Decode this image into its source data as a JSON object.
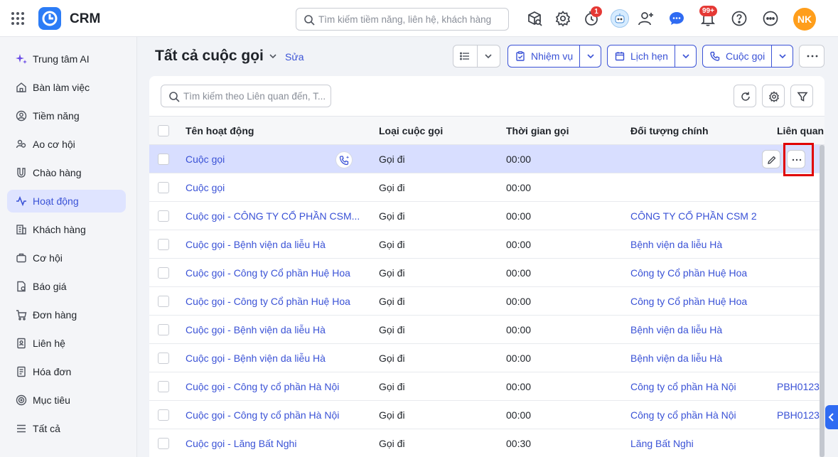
{
  "app": {
    "title": "CRM"
  },
  "search": {
    "placeholder": "Tìm kiếm tiềm năng, liên hệ, khách hàng"
  },
  "topbar": {
    "icons": [
      "package-search-icon",
      "gear-icon",
      "timer-icon",
      "robot-avatar-icon",
      "add-user-icon",
      "chat-icon",
      "bell-icon",
      "help-icon",
      "more-icon"
    ],
    "timer_badge": "1",
    "bell_badge": "99+",
    "avatar_initials": "NK"
  },
  "sidebar": {
    "items": [
      {
        "label": "Trung tâm AI",
        "icon": "sparkle-icon"
      },
      {
        "label": "Bàn làm việc",
        "icon": "home-icon"
      },
      {
        "label": "Tiềm năng",
        "icon": "user-circle-icon"
      },
      {
        "label": "Ao cơ hội",
        "icon": "people-icon"
      },
      {
        "label": "Chào hàng",
        "icon": "magnet-icon"
      },
      {
        "label": "Hoạt động",
        "icon": "activity-icon",
        "active": true
      },
      {
        "label": "Khách hàng",
        "icon": "building-icon"
      },
      {
        "label": "Cơ hội",
        "icon": "briefcase-icon"
      },
      {
        "label": "Báo giá",
        "icon": "quote-doc-icon"
      },
      {
        "label": "Đơn hàng",
        "icon": "cart-icon"
      },
      {
        "label": "Liên hệ",
        "icon": "contact-book-icon"
      },
      {
        "label": "Hóa đơn",
        "icon": "invoice-icon"
      },
      {
        "label": "Mục tiêu",
        "icon": "target-icon"
      },
      {
        "label": "Tất cả",
        "icon": "menu-icon"
      }
    ]
  },
  "header": {
    "title": "Tất cả cuộc gọi",
    "edit_label": "Sửa",
    "buttons": {
      "task": "Nhiệm vụ",
      "appointment": "Lịch hẹn",
      "call": "Cuộc gọi"
    }
  },
  "table": {
    "search_placeholder": "Tìm kiếm theo Liên quan đến, T...",
    "columns": [
      "Tên hoạt động",
      "Loại cuộc gọi",
      "Thời gian gọi",
      "Đối tượng chính",
      "Liên quan đ"
    ],
    "rows": [
      {
        "name": "Cuộc gọi",
        "type": "Gọi đi",
        "time": "00:00",
        "object": "",
        "related": ""
      },
      {
        "name": "Cuộc gọi",
        "type": "Gọi đi",
        "time": "00:00",
        "object": "",
        "related": ""
      },
      {
        "name": "Cuộc gọi - CÔNG TY CỔ PHẦN CSM...",
        "type": "Gọi đi",
        "time": "00:00",
        "object": "CÔNG TY CỔ PHẦN CSM 2",
        "related": ""
      },
      {
        "name": "Cuộc gọi - Bệnh viện da liễu Hà",
        "type": "Gọi đi",
        "time": "00:00",
        "object": "Bệnh viện da liễu Hà",
        "related": ""
      },
      {
        "name": "Cuộc gọi - Công ty Cổ phần Huệ Hoa",
        "type": "Gọi đi",
        "time": "00:00",
        "object": "Công ty Cổ phần Huệ Hoa",
        "related": ""
      },
      {
        "name": "Cuộc gọi - Công ty Cổ phần Huệ Hoa",
        "type": "Gọi đi",
        "time": "00:00",
        "object": "Công ty Cổ phần Huệ Hoa",
        "related": ""
      },
      {
        "name": "Cuộc gọi - Bệnh viện da liễu Hà",
        "type": "Gọi đi",
        "time": "00:00",
        "object": "Bệnh viện da liễu Hà",
        "related": ""
      },
      {
        "name": "Cuộc gọi - Bệnh viện da liễu Hà",
        "type": "Gọi đi",
        "time": "00:00",
        "object": "Bệnh viện da liễu Hà",
        "related": ""
      },
      {
        "name": "Cuộc gọi - Công ty cổ phần Hà Nội",
        "type": "Gọi đi",
        "time": "00:00",
        "object": "Công ty cổ phần Hà Nội",
        "related": "PBH0123"
      },
      {
        "name": "Cuộc gọi - Công ty cổ phần Hà Nội",
        "type": "Gọi đi",
        "time": "00:00",
        "object": "Công ty cổ phần Hà Nội",
        "related": "PBH0123"
      },
      {
        "name": "Cuộc gọi - Lăng Bất Nghi",
        "type": "Gọi đi",
        "time": "00:30",
        "object": "Lăng Bất Nghi",
        "related": ""
      }
    ]
  },
  "colors": {
    "accent": "#3a52d6",
    "selected_row": "#d8deff",
    "highlight": "#e00000",
    "badge": "#e53935",
    "avatar": "#ff9e1b"
  }
}
